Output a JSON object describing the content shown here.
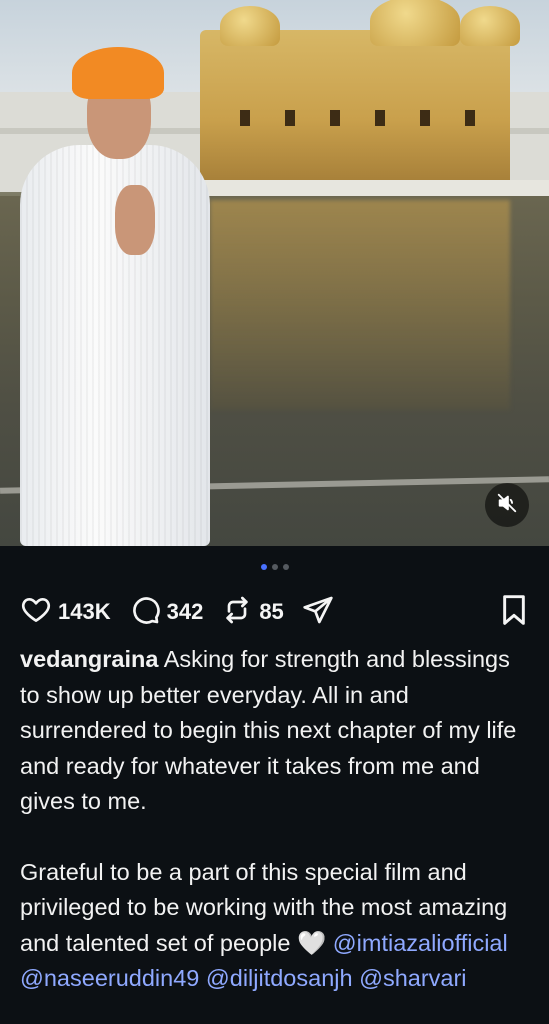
{
  "post": {
    "media_alt_icon": "muted-speaker-icon",
    "carousel": {
      "total": 3,
      "active": 1
    }
  },
  "actions": {
    "likes": "143K",
    "comments": "342",
    "reposts": "85"
  },
  "caption": {
    "username": "vedangraina",
    "paragraph1": "Asking for strength and blessings to show up better everyday. All in and surrendered to begin this next chapter of my life and ready for whatever it takes from me and gives to me.",
    "paragraph2": "Grateful to be a part of this special film and privileged to be working with the most amazing and talented set of people",
    "heart_emoji": "🤍",
    "mentions": [
      "@imtiazaliofficial",
      "@naseeruddin49",
      "@diljitdosanjh",
      "@sharvari"
    ]
  },
  "colors": {
    "background": "#0c1014",
    "mention": "#8fa9ff",
    "carousel_active": "#4a72ff"
  }
}
